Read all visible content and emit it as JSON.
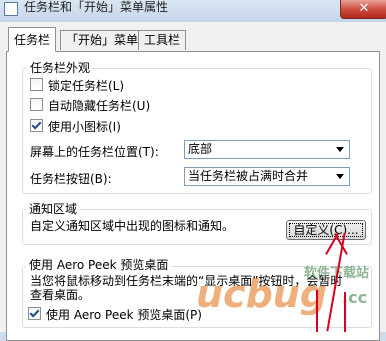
{
  "window": {
    "title": "任务栏和「开始」菜单属性",
    "close_label": "✕"
  },
  "tabs": [
    {
      "label": "任务栏"
    },
    {
      "label": "「开始」菜单"
    },
    {
      "label": "工具栏"
    }
  ],
  "appearance": {
    "title": "任务栏外观",
    "lock_label": "锁定任务栏(L)",
    "autohide_label": "自动隐藏任务栏(U)",
    "small_icons_label": "使用小图标(I)",
    "position_label": "屏幕上的任务栏位置(T):",
    "position_value": "底部",
    "buttons_label": "任务栏按钮(B):",
    "buttons_value": "当任务栏被占满时合并",
    "lock_checked": false,
    "autohide_checked": false,
    "small_icons_checked": true
  },
  "notification": {
    "title": "通知区域",
    "description": "自定义通知区域中出现的图标和通知。",
    "customize_label": "自定义(C)..."
  },
  "aero_peek": {
    "title": "使用 Aero Peek 预览桌面",
    "description_line1": "当您将鼠标移动到任务栏末端的“显示桌面”按钮时，会暂时",
    "description_line2": "查看桌面。",
    "checkbox_label": "使用 Aero Peek 预览桌面(P)",
    "checked": true
  },
  "watermark": {
    "site": "软件下载站",
    "brand": "ucbug",
    "sub": ".cc"
  },
  "colors": {
    "annotation_arrow": "#d8001b",
    "watermark": "#2f7a3a"
  }
}
